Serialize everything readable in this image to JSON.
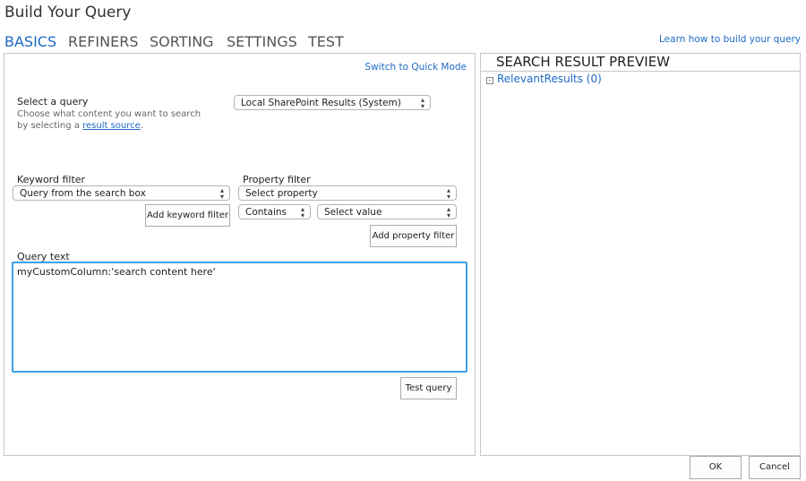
{
  "title": "Build Your Query",
  "tabs": [
    {
      "label": "BASICS",
      "active": true
    },
    {
      "label": "REFINERS"
    },
    {
      "label": "SORTING"
    },
    {
      "label": "SETTINGS"
    },
    {
      "label": "TEST"
    }
  ],
  "learn_link": "Learn how to build your query",
  "switch_link": "Switch to Quick Mode",
  "select_query": {
    "label": "Select a query",
    "desc_prefix": "Choose what content you want to search by selecting a ",
    "desc_link": "result source",
    "desc_suffix": ".",
    "value": "Local SharePoint Results (System)"
  },
  "keyword_filter": {
    "label": "Keyword filter",
    "value": "Query from the search box",
    "add_button": "Add keyword filter"
  },
  "property_filter": {
    "label": "Property filter",
    "property": "Select property",
    "operator": "Contains",
    "value": "Select value",
    "add_button": "Add property filter"
  },
  "query_text": {
    "label": "Query text",
    "value": "myCustomColumn:'search content here'"
  },
  "test_button": "Test query",
  "preview": {
    "title": "SEARCH RESULT PREVIEW",
    "group": "RelevantResults (0)"
  },
  "ok_button": "OK",
  "cancel_button": "Cancel",
  "colors": {
    "accent": "#1e6ac6",
    "focus_border": "#3aa0e8"
  }
}
